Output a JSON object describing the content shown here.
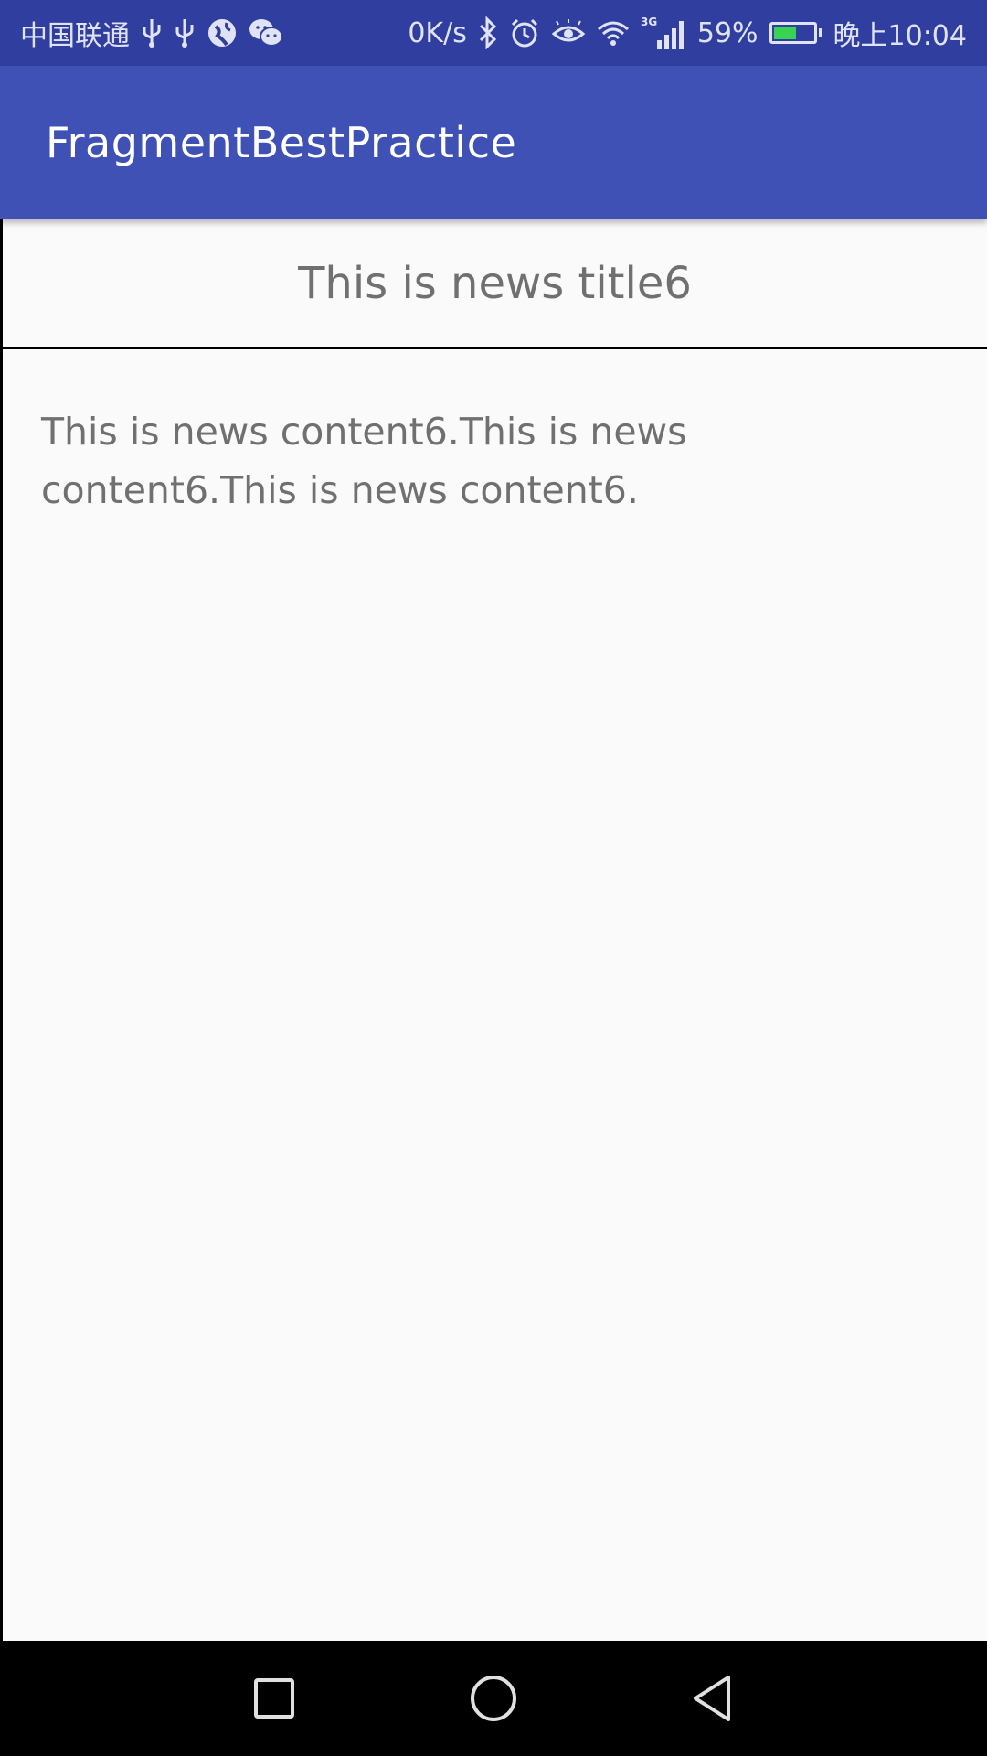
{
  "status_bar": {
    "carrier": "中国联通",
    "left_icons": [
      "usb-icon",
      "usb-icon",
      "vpn-globe-icon",
      "wechat-icon"
    ],
    "net_speed": "0K/s",
    "right_icons": [
      "bluetooth-icon",
      "alarm-icon",
      "eye-comfort-icon",
      "wifi-icon",
      "signal-3g-icon"
    ],
    "network_type": "3G",
    "battery_percent": "59%",
    "battery_level": 0.59,
    "time": "晚上10:04",
    "colors": {
      "background": "#303f9f",
      "foreground": "#dfe3f5",
      "battery_fill": "#39d353"
    }
  },
  "app_bar": {
    "title": "FragmentBestPractice",
    "color": "#3f51b5"
  },
  "news": {
    "title": "This is news title6",
    "content": "This is news content6.This is news content6.This is news content6.",
    "text_color": "#707070"
  },
  "nav_bar": {
    "buttons": [
      "recents-square-icon",
      "home-circle-icon",
      "back-triangle-icon"
    ]
  }
}
